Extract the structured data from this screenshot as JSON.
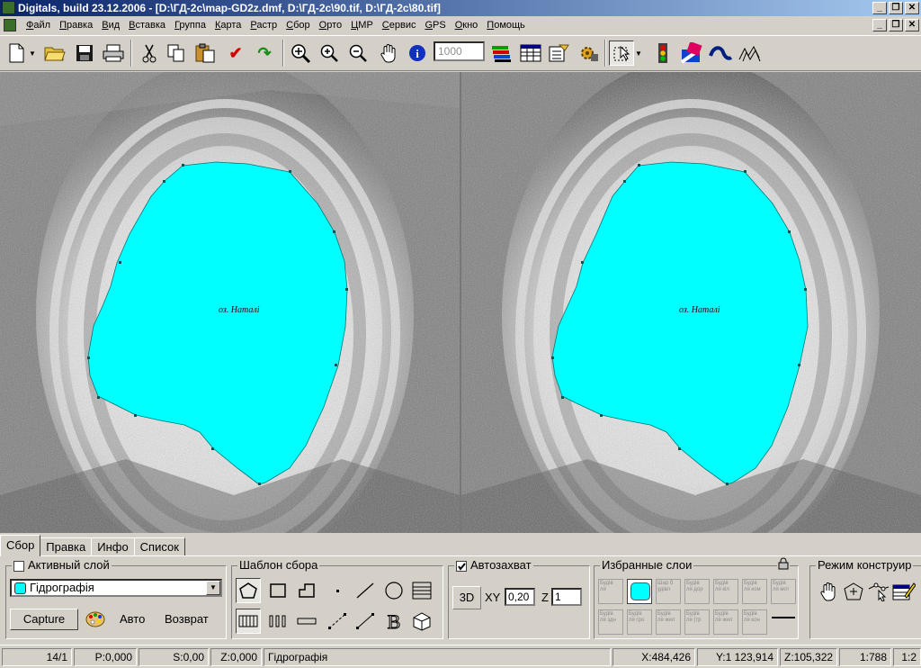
{
  "title": "Digitals, build 23.12.2006 - [D:\\ГД-2с\\map-GD2z.dmf, D:\\ГД-2с\\90.tif, D:\\ГД-2с\\80.tif]",
  "window_buttons": {
    "minimize": "_",
    "restore": "❐",
    "close": "✕"
  },
  "menu": [
    "Файл",
    "Правка",
    "Вид",
    "Вставка",
    "Группа",
    "Карта",
    "Растр",
    "Сбор",
    "Орто",
    "ЦМР",
    "Сервис",
    "GPS",
    "Окно",
    "Помощь"
  ],
  "toolbar": {
    "scale_value": "1000",
    "icons": [
      "new-document-icon",
      "dropdown-arrow-icon",
      "open-folder-icon",
      "save-icon",
      "print-icon",
      "cut-icon",
      "copy-icon",
      "paste-icon",
      "check-icon",
      "redo-icon",
      "zoom-extent-icon",
      "zoom-in-icon",
      "zoom-out-icon",
      "pan-hand-icon",
      "info-icon",
      "layers-icon",
      "table-icon",
      "properties-icon",
      "settings-icon",
      "select-tool-icon",
      "select-dropdown-icon",
      "traffic-light-icon",
      "brush-icon",
      "curve-icon",
      "stereo-icon"
    ]
  },
  "views": {
    "left_label": "оз. Наталі",
    "right_label": "оз. Наталі",
    "lake_color": "#00ffff"
  },
  "tabs": [
    {
      "label": "Сбор",
      "active": true
    },
    {
      "label": "Правка",
      "active": false
    },
    {
      "label": "Инфо",
      "active": false
    },
    {
      "label": "Список",
      "active": false
    }
  ],
  "active_layer": {
    "title": "Активный слой",
    "selected": "Гідрографія",
    "swatch_color": "#00ffff",
    "capture_button": "Capture",
    "auto_label": "Авто",
    "return_label": "Возврат"
  },
  "template": {
    "title": "Шаблон сбора"
  },
  "autocapture": {
    "title": "Автозахват",
    "checked": true,
    "btn_3d": "3D",
    "xy_label": "XY",
    "xy_value": "0,20",
    "z_label": "Z",
    "z_value": "1"
  },
  "favorites": {
    "title": "Избранные слои",
    "row1": [
      "Будів\nля",
      "",
      "Шар б\nудівл",
      "Будів\nля дор",
      "Будів\nля кіл",
      "Будів\nля ком",
      "Будів\nля мот"
    ],
    "row2": [
      "Будів\nля здн",
      "Будів\nля гро",
      "Будів\nля жил",
      "Будів\nля (тр",
      "Будів\nля жил",
      "Будів\nля кон",
      ""
    ]
  },
  "construct_mode": {
    "title": "Режим конструир"
  },
  "status": {
    "count": "14/1",
    "p": "P:0,000",
    "s": "S:0,00",
    "z": "Z:0,000",
    "layer": "Гідрографія",
    "x": "X:484,426",
    "y": "Y:1 123,914",
    "zc": "Z:105,322",
    "scale": "1:788",
    "ratio": "1:2"
  }
}
